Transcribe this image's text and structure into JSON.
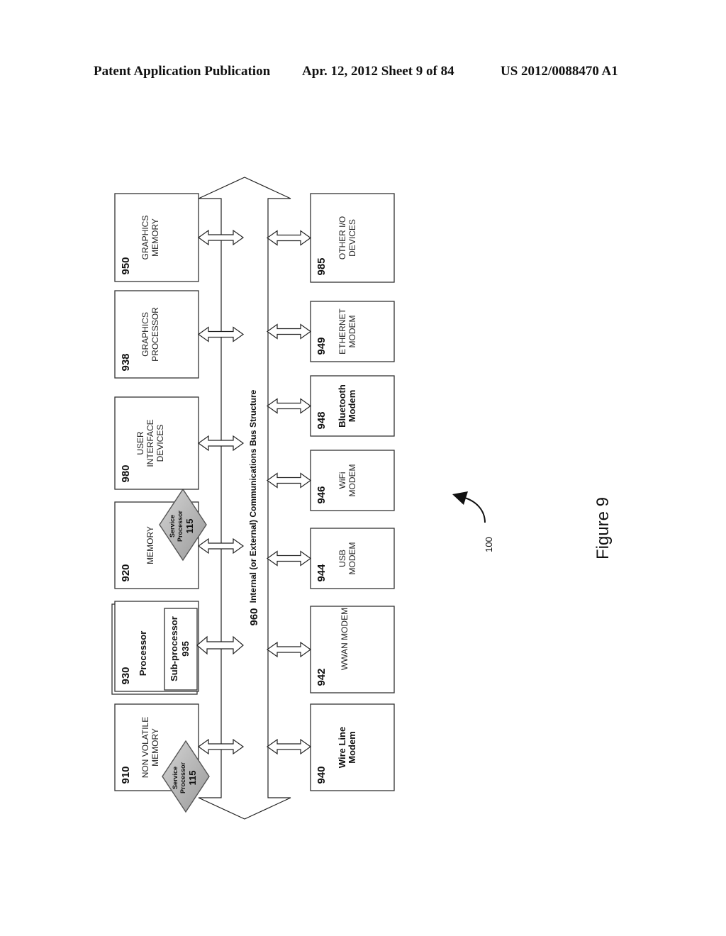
{
  "header": {
    "publication": "Patent Application Publication",
    "date_sheet": "Apr. 12, 2012  Sheet 9 of 84",
    "patent_number": "US 2012/0088470 A1"
  },
  "figure": {
    "caption": "Figure 9",
    "reference_number": "100"
  },
  "bus": {
    "number": "960",
    "label": "Internal (or External) Communications Bus Structure"
  },
  "top_blocks": [
    {
      "id": "910",
      "lines": [
        "NON VOLATILE",
        "MEMORY"
      ],
      "service_processor": true
    },
    {
      "id": "930",
      "lines": [
        "Processor"
      ],
      "sub_processor": {
        "label": "Sub-processor",
        "id": "935"
      }
    },
    {
      "id": "920",
      "lines": [
        "MEMORY"
      ],
      "service_processor": true
    },
    {
      "id": "980",
      "lines": [
        "USER",
        "INTERFACE",
        "DEVICES"
      ]
    },
    {
      "id": "938",
      "lines": [
        "GRAPHICS",
        "PROCESSOR"
      ]
    },
    {
      "id": "950",
      "lines": [
        "GRAPHICS",
        "MEMORY"
      ]
    }
  ],
  "bottom_blocks": [
    {
      "id": "940",
      "lines": [
        "Wire Line",
        "Modem"
      ],
      "bold": true
    },
    {
      "id": "942",
      "lines": [
        "WWAN MODEM"
      ]
    },
    {
      "id": "944",
      "lines": [
        "USB",
        "MODEM"
      ]
    },
    {
      "id": "946",
      "lines": [
        "WiFi",
        "MODEM"
      ]
    },
    {
      "id": "948",
      "lines": [
        "Bluetooth",
        "Modem"
      ],
      "bold": true
    },
    {
      "id": "949",
      "lines": [
        "ETHERNET",
        "MODEM"
      ]
    },
    {
      "id": "985",
      "lines": [
        "OTHER I/O",
        "DEVICES"
      ]
    }
  ],
  "service_processor": {
    "label_line1": "Service",
    "label_line2": "Processor",
    "id": "115"
  }
}
